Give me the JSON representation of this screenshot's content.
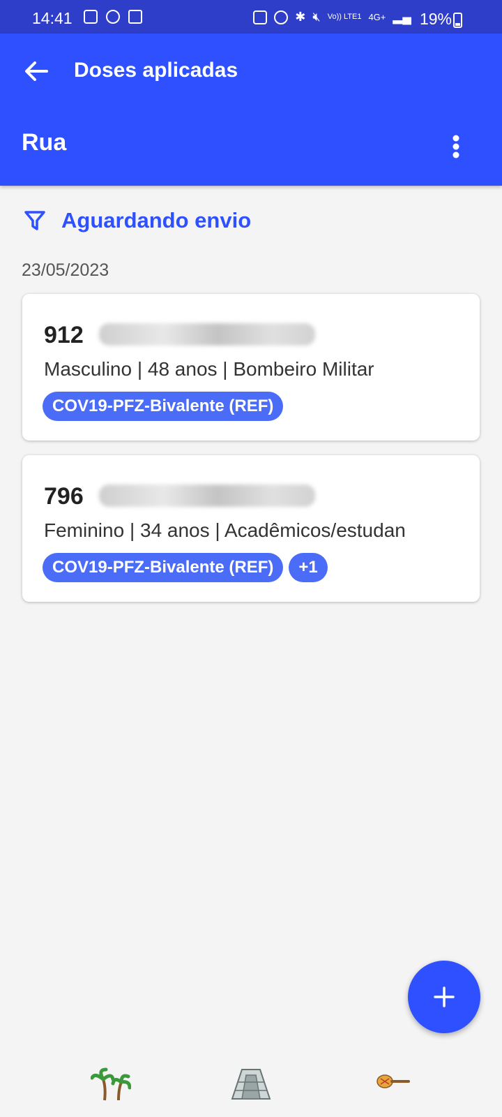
{
  "status_bar": {
    "time": "14:41",
    "battery": "19%",
    "network": "4G+",
    "volte": "Vo)) LTE1"
  },
  "app_bar": {
    "title": "Doses aplicadas",
    "subtitle": "Rua"
  },
  "filter": {
    "label": "Aguardando envio"
  },
  "date_group": "23/05/2023",
  "records": [
    {
      "number": "912",
      "info": "Masculino | 48 anos | Bombeiro Militar",
      "chips": [
        "COV19-PFZ-Bivalente (REF)"
      ]
    },
    {
      "number": "796",
      "info": "Feminino | 34 anos | Acadêmicos/estudan",
      "chips": [
        "COV19-PFZ-Bivalente (REF)",
        "+1"
      ]
    }
  ],
  "bottom_icons": [
    "palm-trees-icon",
    "pyramid-icon",
    "maraca-icon"
  ],
  "colors": {
    "status_bar": "#2f3ec9",
    "primary": "#2f50ff",
    "chip": "#4a6cf7",
    "background": "#f4f4f4"
  }
}
